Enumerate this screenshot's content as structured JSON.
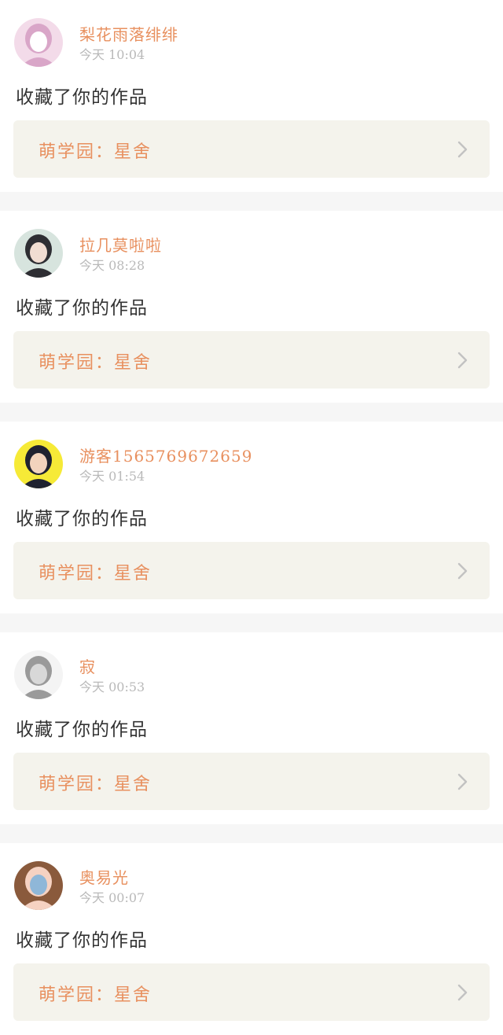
{
  "feed": {
    "items": [
      {
        "username": "梨花雨落绯绯",
        "time": "今天 10:04",
        "action": "收藏了你的作品",
        "work": "萌学园：星舍",
        "avatar_icon": "anime-girl-pink-avatar",
        "avatar_colors": [
          "#f3dbe9",
          "#d9a6c8",
          "#ffffff"
        ]
      },
      {
        "username": "拉几莫啦啦",
        "time": "今天 08:28",
        "action": "收藏了你的作品",
        "work": "萌学园：星舍",
        "avatar_icon": "young-man-photo-avatar",
        "avatar_colors": [
          "#d7e4de",
          "#2e2e33",
          "#f1ddd2"
        ]
      },
      {
        "username": "游客1565769672659",
        "time": "今天 01:54",
        "action": "收藏了你的作品",
        "work": "萌学园：星舍",
        "avatar_icon": "man-yellow-background-avatar",
        "avatar_colors": [
          "#f6ea37",
          "#1f2230",
          "#f2d3bd"
        ]
      },
      {
        "username": "寂",
        "time": "今天 00:53",
        "action": "收藏了你的作品",
        "work": "萌学园：星舍",
        "avatar_icon": "sketch-drawing-avatar",
        "avatar_colors": [
          "#f4f4f4",
          "#9a9a9a",
          "#d8d8d8"
        ]
      },
      {
        "username": "奥易光",
        "time": "今天 00:07",
        "action": "收藏了你的作品",
        "work": "萌学园：星舍",
        "avatar_icon": "anime-girl-brown-hair-avatar",
        "avatar_colors": [
          "#8a5a3c",
          "#f6d2c2",
          "#8fb7d8"
        ]
      }
    ]
  },
  "colors": {
    "accent": "#e8905f",
    "time_gray": "#b9b9b9",
    "work_box_bg": "#f4f3ec",
    "separator": "#f6f6f6"
  }
}
